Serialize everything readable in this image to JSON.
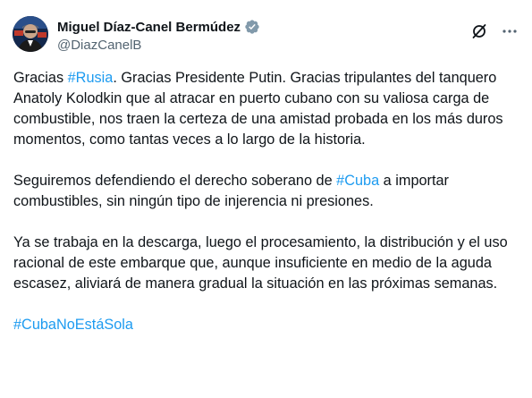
{
  "author": {
    "display_name": "Miguel Díaz-Canel Bermúdez",
    "handle": "@DiazCanelB",
    "verified_badge_color": "#829aab",
    "avatar_icon": "profile-photo"
  },
  "actions": {
    "grok_icon": "grok-slash-icon",
    "more_icon": "ellipsis-icon"
  },
  "colors": {
    "text": "#0f1419",
    "secondary_text": "#536471",
    "link": "#1d9bf0"
  },
  "tweet": {
    "p1": {
      "t1": "Gracias ",
      "tag1": "#Rusia",
      "t2": ". Gracias Presidente Putin. Gracias tripulantes del tanquero Anatoly Kolodkin que al atracar en puerto cubano con su valiosa carga de combustible, nos traen la certeza de una amistad probada en los más duros momentos, como tantas veces a lo largo de la historia."
    },
    "p2": {
      "t1": "Seguiremos defendiendo el derecho soberano de ",
      "tag1": "#Cuba",
      "t2": " a importar combustibles, sin ningún tipo de injerencia ni presiones."
    },
    "p3": {
      "t1": "Ya se trabaja en la descarga, luego el procesamiento, la distribución y el uso racional de este embarque que, aunque insuficiente en medio de la aguda escasez, aliviará de manera gradual la situación en las próximas semanas."
    },
    "p4": {
      "tag1": "#CubaNoEstáSola"
    }
  }
}
